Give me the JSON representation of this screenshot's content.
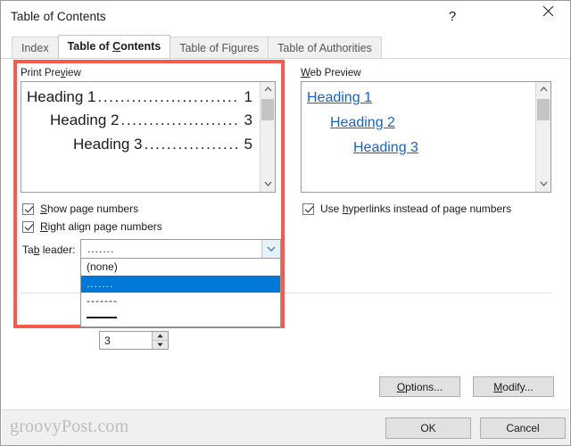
{
  "window": {
    "title": "Table of Contents",
    "help_icon": "question-mark-icon",
    "close_icon": "close-icon"
  },
  "tabs": [
    {
      "label": "Index",
      "accel": "",
      "active": false
    },
    {
      "label": "Table of Contents",
      "accel": "C",
      "active": true
    },
    {
      "label": "Table of Figures",
      "accel": "",
      "active": false
    },
    {
      "label": "Table of Authorities",
      "accel": "",
      "active": false
    }
  ],
  "print_preview": {
    "label": "Print Preview",
    "label_pre": "Print Pre",
    "label_accel": "v",
    "label_post": "iew",
    "rows": [
      {
        "text": "Heading 1",
        "leader": "...................................",
        "page": "1",
        "level": 1
      },
      {
        "text": "Heading 2",
        "leader": "...............................",
        "page": "3",
        "level": 2
      },
      {
        "text": "Heading 3",
        "leader": ".........................",
        "page": "5",
        "level": 3
      }
    ],
    "scrollbar": {
      "up_icon": "chevron-up-icon",
      "down_icon": "chevron-down-icon"
    }
  },
  "web_preview": {
    "label_pre": "",
    "label_accel": "W",
    "label_post": "eb Preview",
    "rows": [
      {
        "text": "Heading 1",
        "level": 1
      },
      {
        "text": "Heading 2",
        "level": 2
      },
      {
        "text": "Heading 3",
        "level": 3
      }
    ],
    "link_color": "#1664c0",
    "scrollbar": {
      "up_icon": "chevron-up-icon",
      "down_icon": "chevron-down-icon"
    }
  },
  "checkboxes": {
    "show_page_numbers": {
      "pre": "",
      "accel": "S",
      "post": "how page numbers",
      "checked": true
    },
    "right_align_page_numbers": {
      "pre": "",
      "accel": "R",
      "post": "ight align page numbers",
      "checked": true
    },
    "use_hyperlinks": {
      "pre": "Use ",
      "accel": "h",
      "post": "yperlinks instead of page numbers",
      "checked": true
    }
  },
  "tab_leader": {
    "label_pre": "Ta",
    "label_accel": "b",
    "label_post": " leader:",
    "selected_value": ".......",
    "arrow_icon": "chevron-down-icon",
    "expanded": true,
    "options": [
      {
        "label": "(none)",
        "style": "text",
        "selected": false
      },
      {
        "label": ".......",
        "style": "dots",
        "selected": true
      },
      {
        "label": "-------",
        "style": "dashes",
        "selected": false
      },
      {
        "label": "",
        "style": "line",
        "selected": false
      }
    ]
  },
  "levels_spinner": {
    "value": "3",
    "up_icon": "triangle-up-icon",
    "down_icon": "triangle-down-icon"
  },
  "buttons": {
    "options": {
      "pre": "",
      "accel": "O",
      "post": "ptions..."
    },
    "modify": {
      "pre": "",
      "accel": "M",
      "post": "odify..."
    },
    "ok": "OK",
    "cancel": "Cancel"
  },
  "watermark": "groovyPost.com",
  "colors": {
    "accent_selection": "#0078d7",
    "link": "#1664c0",
    "highlight_red": "#fa5a4b",
    "footer_bg": "#f0f0f0"
  }
}
